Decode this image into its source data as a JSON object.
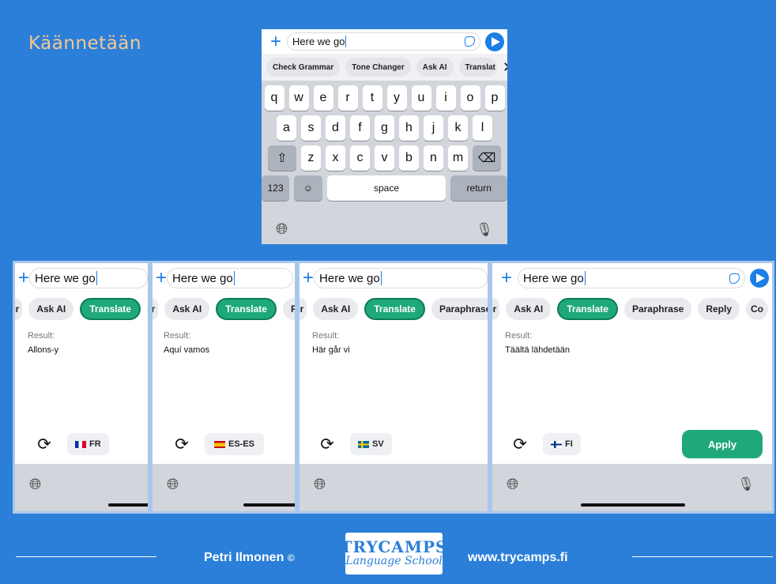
{
  "slide": {
    "title": "Käännetään"
  },
  "input": {
    "text": "Here we go"
  },
  "keyboard": {
    "chips": [
      "Check Grammar",
      "Tone Changer",
      "Ask AI",
      "Translat"
    ],
    "rows": [
      [
        "q",
        "w",
        "e",
        "r",
        "t",
        "y",
        "u",
        "i",
        "o",
        "p"
      ],
      [
        "a",
        "s",
        "d",
        "f",
        "g",
        "h",
        "j",
        "k",
        "l"
      ],
      [
        "z",
        "x",
        "c",
        "v",
        "b",
        "n",
        "m"
      ]
    ],
    "key_123": "123",
    "key_space": "space",
    "key_return": "return"
  },
  "panels": [
    {
      "chips": [
        "er",
        "Ask AI",
        "Translate",
        "Pa"
      ],
      "result_label": "Result:",
      "result": "Allons-y",
      "lang": "FR",
      "flag_colors": [
        "#0033a0",
        "#ffffff",
        "#e4002b"
      ]
    },
    {
      "chips": [
        "er",
        "Ask AI",
        "Translate",
        "Pa"
      ],
      "result_label": "Result:",
      "result": "Aquí vamos",
      "lang": "ES-ES",
      "flag_colors": [
        "#c60b1e",
        "#ffc400",
        "#c60b1e"
      ]
    },
    {
      "chips": [
        "er",
        "Ask AI",
        "Translate",
        "Paraphrase"
      ],
      "result_label": "Result:",
      "result": "Här går vi",
      "lang": "SV",
      "flag_colors": [
        "#006aa7",
        "#fecc00",
        "#006aa7"
      ]
    },
    {
      "chips": [
        "er",
        "Ask AI",
        "Translate",
        "Paraphrase",
        "Reply",
        "Co"
      ],
      "result_label": "Result:",
      "result": "Täältä lähdetään",
      "lang": "FI",
      "flag_colors": [
        "#ffffff",
        "#003580",
        "#ffffff"
      ],
      "apply_label": "Apply"
    }
  ],
  "footer": {
    "author": "Petri Ilmonen",
    "copyright": "©",
    "logo_top": "TRYCAMPS",
    "logo_bottom": "Language School",
    "website": "www.trycamps.fi"
  },
  "colors": {
    "accent": "#1a7fe6",
    "active_chip": "#1fa97b",
    "background": "#2b7fd9",
    "title": "#f5c892"
  }
}
